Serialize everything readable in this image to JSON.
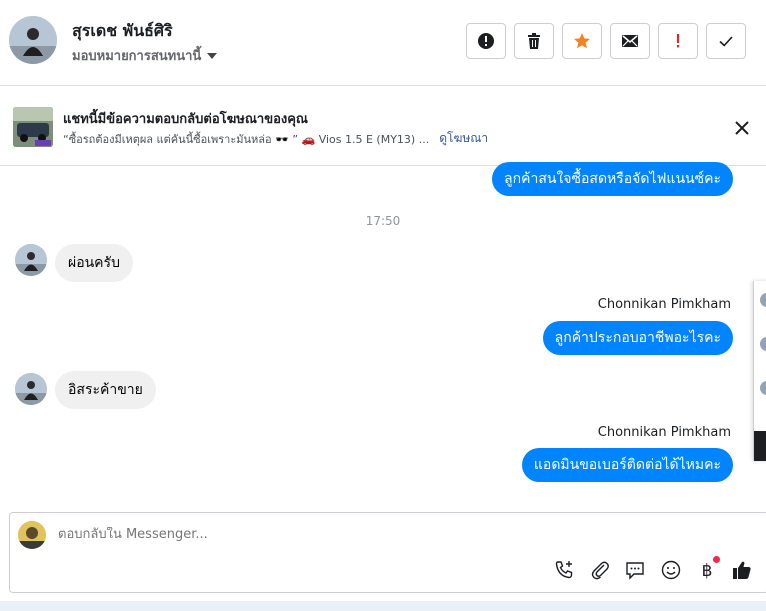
{
  "header": {
    "contact_name": "สุรเดช พันธ์ศิริ",
    "assign_label": "มอบหมายการสนทนานี้",
    "actions": [
      {
        "icon": "alert-circle-icon",
        "name": "mark-spam-button"
      },
      {
        "icon": "trash-icon",
        "name": "delete-button"
      },
      {
        "icon": "star-icon",
        "name": "star-button"
      },
      {
        "icon": "envelope-icon",
        "name": "mark-unread-button"
      },
      {
        "icon": "exclamation-icon",
        "name": "follow-up-button"
      },
      {
        "icon": "check-icon",
        "name": "mark-done-button"
      }
    ]
  },
  "ad_banner": {
    "title": "แชทนี้มีข้อความตอบกลับต่อโฆษณาของคุณ",
    "snippet": "“ซื้อรถต้องมีเหตุผล แต่คันนี้ซื้อเพราะมันหล่อ 🕶️ ” 🚗 Vios 1.5 E (MY13) ...",
    "link_label": "ดูโฆษณา"
  },
  "messages": {
    "out_1": "ลูกค้าสนใจซื้อสดหรือจัดไฟแนนซ์คะ",
    "timestamp": "17:50",
    "in_1": "ผ่อนครับ",
    "sender_2": "Chonnikan Pimkham",
    "out_2": "ลูกค้าประกอบอาชีพอะไรคะ",
    "in_2": "อิสระค้าขาย",
    "sender_3": "Chonnikan Pimkham",
    "out_3": "แอดมินขอเบอร์ติดต่อได้ไหมคะ"
  },
  "composer": {
    "placeholder": "ตอบกลับใน Messenger...",
    "currency_symbol": "฿"
  },
  "colors": {
    "accent": "#0084ff",
    "star": "#f5821f",
    "followup": "#e02828"
  }
}
